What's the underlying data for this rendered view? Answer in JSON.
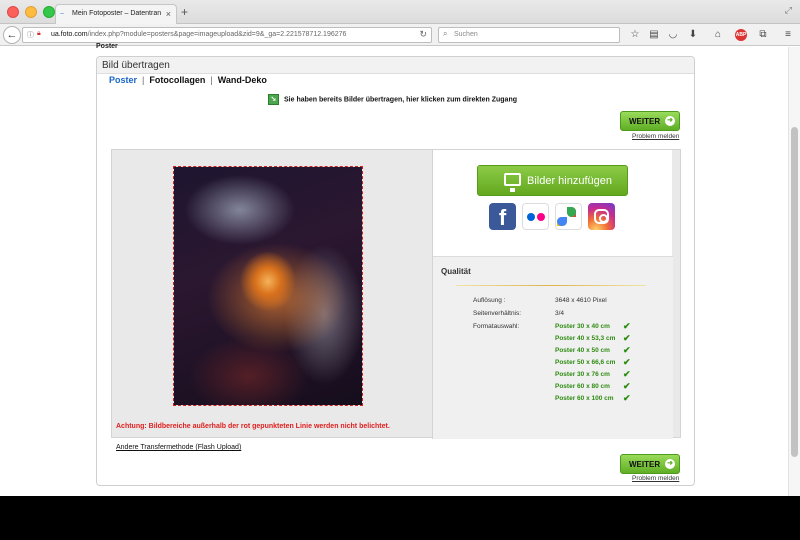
{
  "browser": {
    "tab_title": "Mein Fotoposter – Datentran",
    "url_domain": "ua.foto.com",
    "url_path": "/index.php?module=posters&page=imageupload&zid=9&_ga=2.221578712.196276",
    "search_placeholder": "Suchen",
    "adblock_label": "ABP"
  },
  "page": {
    "breadcrumb": "Poster",
    "card_title": "Bild übertragen",
    "tabs": [
      "Poster",
      "Fotocollagen",
      "Wand-Deko"
    ],
    "already_uploaded": "Sie haben bereits Bilder übertragen, hier klicken zum direkten Zugang",
    "weiter_label": "WEITER",
    "problem_label": "Problem melden",
    "add_images_label": "Bilder hinzufügen",
    "facebook_glyph": "f",
    "warning": "Achtung: Bildbereiche außerhalb der rot gepunkteten Linie werden nicht belichtet.",
    "other_method": "Andere Transfermethode (Flash Upload)"
  },
  "quality": {
    "title": "Qualität",
    "rows": [
      {
        "key": "Auflösung :",
        "value": "3648 x 4610 Pixel"
      },
      {
        "key": "Seitenverhältnis:",
        "value": "3/4"
      }
    ],
    "format_key": "Formatauswahl:",
    "formats": [
      "Poster 30 x 40 cm",
      "Poster 40 x 53,3 cm",
      "Poster 40 x 50 cm",
      "Poster 50 x 66,6 cm",
      "Poster 30 x 76 cm",
      "Poster 60 x 80 cm",
      "Poster 60 x 100 cm"
    ]
  },
  "colors": {
    "accent_green": "#63a81f",
    "warning_red": "#e02020",
    "link_blue": "#1a66c5",
    "format_green": "#2e8b12"
  },
  "icons": [
    "back-arrow-icon",
    "info-icon",
    "lock-icon",
    "reload-icon",
    "search-icon",
    "star-icon",
    "clipboard-icon",
    "pocket-icon",
    "download-icon",
    "home-icon",
    "adblock-icon",
    "screenshot-icon",
    "menu-icon",
    "monitor-icon",
    "facebook-icon",
    "flickr-icon",
    "google-photos-icon",
    "instagram-icon",
    "checkmark-icon",
    "arrow-right-icon"
  ]
}
